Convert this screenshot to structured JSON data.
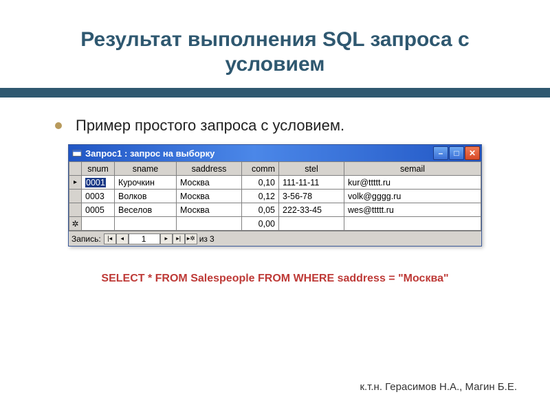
{
  "title": "Результат выполнения SQL запроса с условием",
  "bullet": "Пример простого запроса с условием.",
  "window": {
    "title": "Запрос1 : запрос на выборку",
    "columns": [
      "snum",
      "sname",
      "saddress",
      "comm",
      "stel",
      "semail"
    ],
    "rows": [
      {
        "marker": "▸",
        "snum": "0001",
        "sname": "Курочкин",
        "saddress": "Москва",
        "comm": "0,10",
        "stel": "111-11-11",
        "semail": "kur@ttttt.ru"
      },
      {
        "marker": "",
        "snum": "0003",
        "sname": "Волков",
        "saddress": "Москва",
        "comm": "0,12",
        "stel": "3-56-78",
        "semail": "volk@gggg.ru"
      },
      {
        "marker": "",
        "snum": "0005",
        "sname": "Веселов",
        "saddress": "Москва",
        "comm": "0,05",
        "stel": "222-33-45",
        "semail": "wes@ttttt.ru"
      },
      {
        "marker": "✲",
        "snum": "",
        "sname": "",
        "saddress": "",
        "comm": "0,00",
        "stel": "",
        "semail": ""
      }
    ],
    "statusbar": {
      "label": "Запись:",
      "current": "1",
      "total_prefix": "из",
      "total": "3"
    }
  },
  "sql": "SELECT * FROM Salespeople FROM WHERE saddress = \"Москва\"",
  "footer": "к.т.н. Герасимов Н.А., Магин Б.Е."
}
